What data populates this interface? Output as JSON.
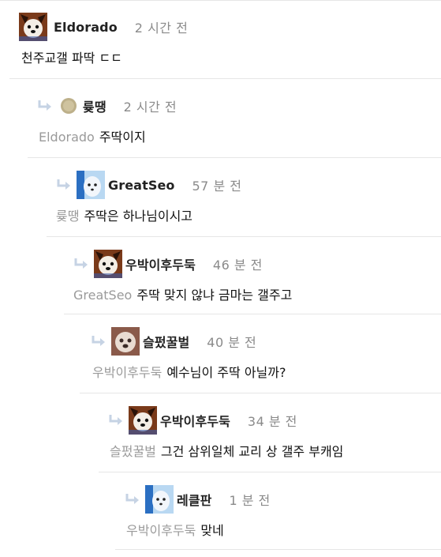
{
  "comments": [
    {
      "author": "Eldorado",
      "time": "2 시간 전",
      "avatar": "dog-avatar",
      "is_reply": false,
      "mention": "",
      "text": "천주교갤 파딱 ㄷㄷ"
    },
    {
      "author": "륮땡",
      "time": "2 시간 전",
      "avatar": "beige-circle-avatar",
      "is_reply": true,
      "mention": "Eldorado",
      "text": "주딱이지"
    },
    {
      "author": "GreatSeo",
      "time": "57 분 전",
      "avatar": "ghost-avatar",
      "is_reply": true,
      "mention": "륮땡",
      "text": "주딱은 하나님이시고"
    },
    {
      "author": "우박이후두둑",
      "time": "46 분 전",
      "avatar": "dog-avatar",
      "is_reply": true,
      "mention": "GreatSeo",
      "text": "주딱 맞지 않냐 금마는 갤주고"
    },
    {
      "author": "슬펐꿀벌",
      "time": "40 분 전",
      "avatar": "blurred-dog-avatar",
      "is_reply": true,
      "mention": "우박이후두둑",
      "text": "예수님이 주딱 아닐까?"
    },
    {
      "author": "우박이후두둑",
      "time": "34 분 전",
      "avatar": "dog-avatar",
      "is_reply": true,
      "mention": "슬펐꿀벌",
      "text": "그건 삼위일체 교리 상 갤주 부캐임"
    },
    {
      "author": "레클판",
      "time": "1 분 전",
      "avatar": "ghost-avatar",
      "is_reply": true,
      "mention": "우박이후두둑",
      "text": "맞네"
    }
  ],
  "colors": {
    "reply_arrow": "#c6d3e4",
    "mention": "#9a9a9a",
    "time": "#8a8a8a",
    "divider": "#e6e6e6"
  }
}
